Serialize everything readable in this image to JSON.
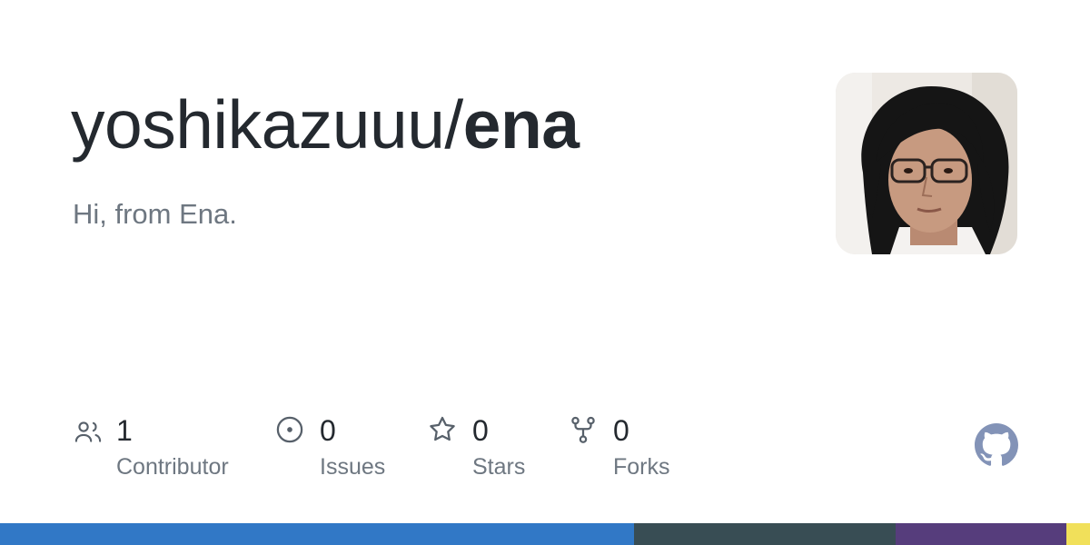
{
  "repo": {
    "owner": "yoshikazuuu/",
    "name": "ena",
    "description": "Hi, from Ena."
  },
  "avatar": {
    "icon": "user-avatar-photo"
  },
  "stats": [
    {
      "icon": "people-icon",
      "count": "1",
      "label": "Contributor"
    },
    {
      "icon": "issue-icon",
      "count": "0",
      "label": "Issues"
    },
    {
      "icon": "star-icon",
      "count": "0",
      "label": "Stars"
    },
    {
      "icon": "fork-icon",
      "count": "0",
      "label": "Forks"
    }
  ],
  "brand": {
    "icon": "github-logo-icon",
    "color": "#8393b7"
  },
  "languages": [
    {
      "color": "#3178c6",
      "fraction": 0.5817
    },
    {
      "color": "#384d54",
      "fraction": 0.24
    },
    {
      "color": "#563d7c",
      "fraction": 0.1567
    },
    {
      "color": "#f1e05a",
      "fraction": 0.0216
    }
  ],
  "colors": {
    "title": "#24292f",
    "muted": "#6e7781",
    "icon": "#57606a"
  }
}
